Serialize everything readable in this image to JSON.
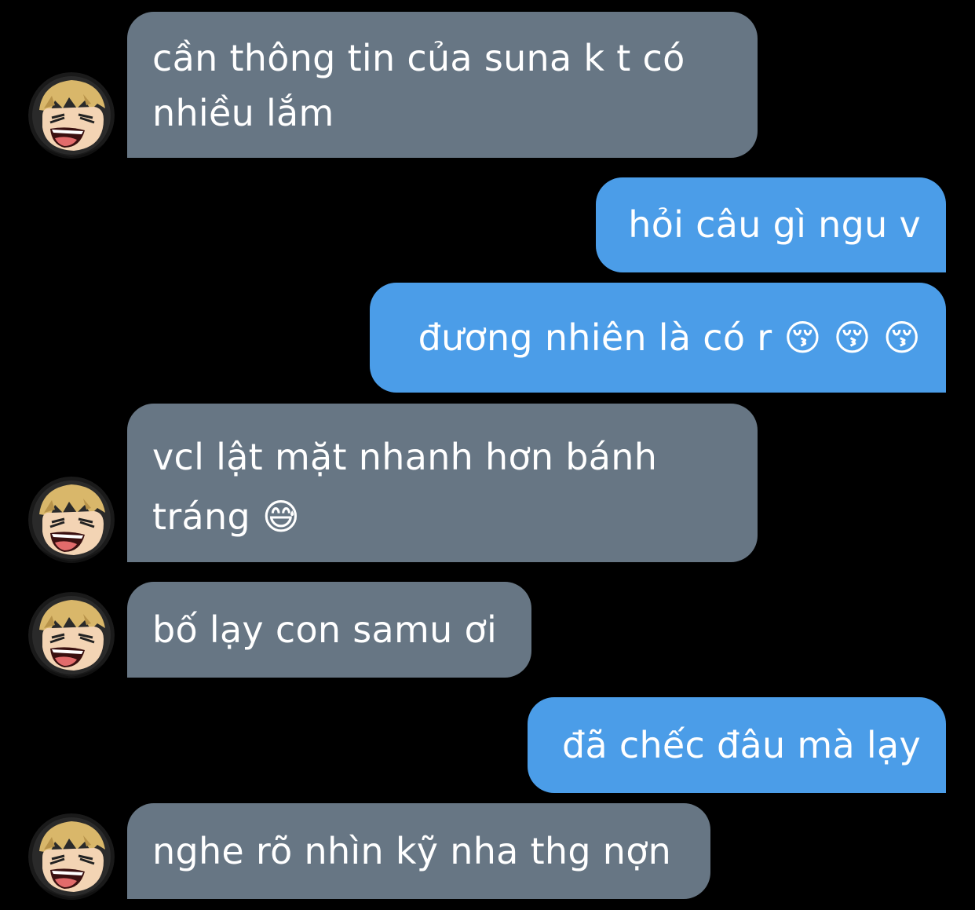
{
  "chat": {
    "contact": {
      "avatar_icon": "anime-laughing-face-icon"
    },
    "colors": {
      "background": "#000000",
      "incoming_bubble": "#677684",
      "outgoing_bubble": "#4b9de8",
      "text": "#ffffff"
    },
    "messages": [
      {
        "direction": "incoming",
        "text": "cần thông tin của suna k t có nhiều lắm"
      },
      {
        "direction": "outgoing",
        "text": "hỏi câu gì ngu v"
      },
      {
        "direction": "outgoing",
        "text": "đương nhiên là có r 😚 😚 😚"
      },
      {
        "direction": "incoming",
        "text": "vcl lật mặt nhanh hơn bánh tráng 😅"
      },
      {
        "direction": "incoming",
        "text": "bố lạy con samu ơi"
      },
      {
        "direction": "outgoing",
        "text": "đã chếc đâu mà lạy"
      },
      {
        "direction": "incoming",
        "text": "nghe rõ nhìn kỹ nha thg nợn"
      }
    ]
  }
}
